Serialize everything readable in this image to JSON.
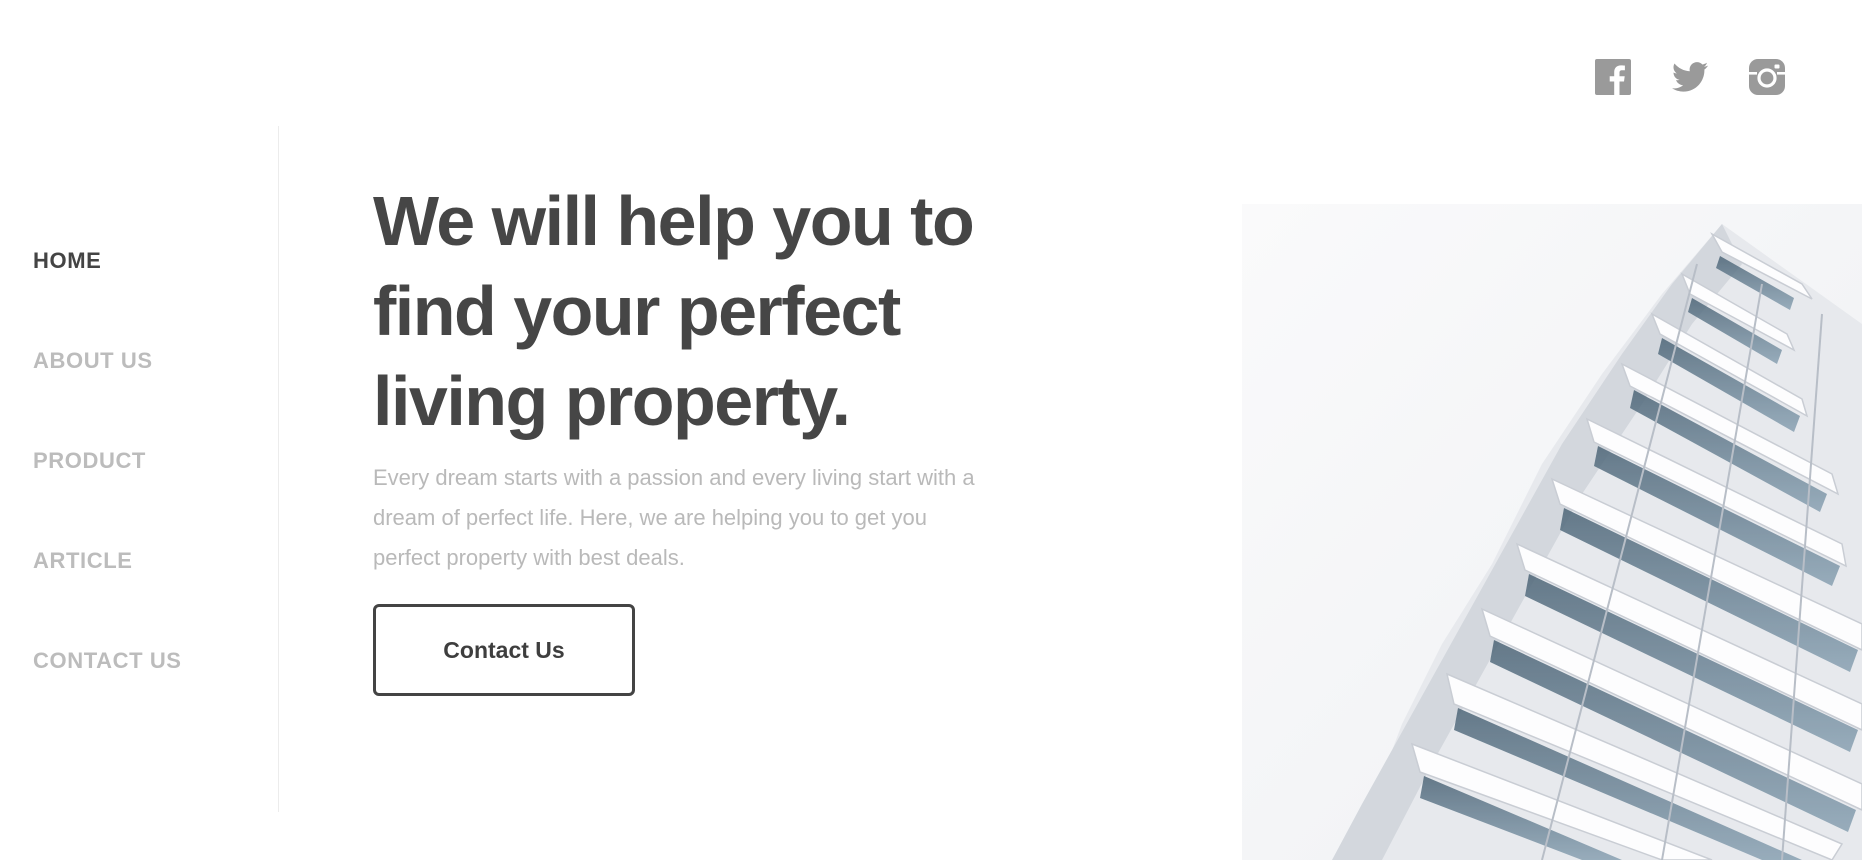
{
  "social": [
    {
      "name": "facebook",
      "icon": "facebook-icon"
    },
    {
      "name": "twitter",
      "icon": "twitter-icon"
    },
    {
      "name": "instagram",
      "icon": "instagram-icon"
    }
  ],
  "nav": {
    "items": [
      {
        "label": "HOME",
        "active": true
      },
      {
        "label": "ABOUT US",
        "active": false
      },
      {
        "label": "PRODUCT",
        "active": false
      },
      {
        "label": "ARTICLE",
        "active": false
      },
      {
        "label": "CONTACT US",
        "active": false
      }
    ]
  },
  "hero": {
    "title_lines": [
      "We will help you to",
      "find your perfect",
      "living property."
    ],
    "description_lines": [
      "Every dream starts with a passion and every living start with a",
      "dream of perfect life. Here, we are helping you to get you",
      "perfect property with best deals."
    ],
    "cta_label": "Contact Us"
  },
  "colors": {
    "text_dark": "#444444",
    "text_muted": "#bcbcbc",
    "icon_gray": "#9a9a9a",
    "background": "#ffffff"
  }
}
